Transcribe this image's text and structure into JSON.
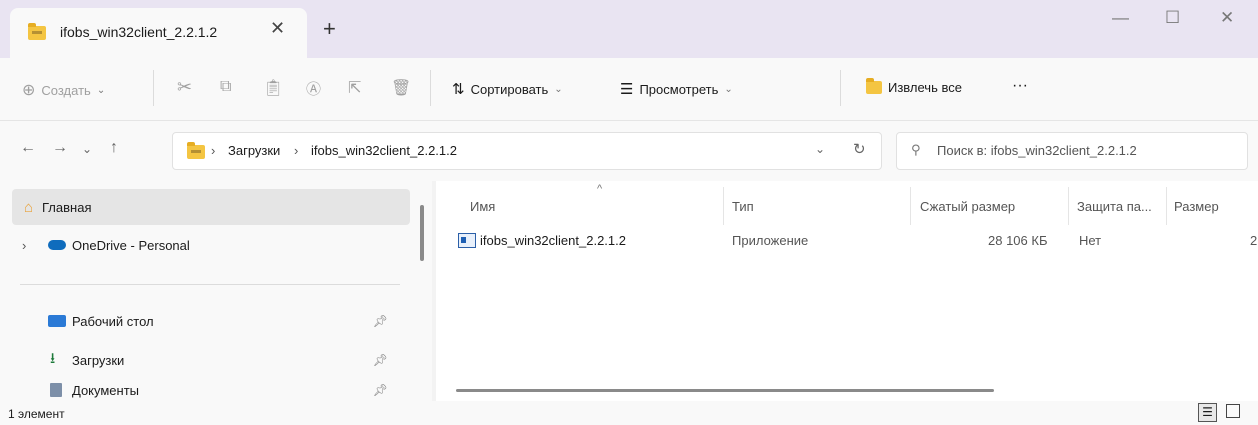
{
  "window": {
    "tab_title": "ifobs_win32client_2.2.1.2",
    "close_tab": "✕",
    "new_tab": "+",
    "minimize": "—",
    "maximize": "☐",
    "close": "✕"
  },
  "toolbar": {
    "create": "Создать",
    "sort": "Сортировать",
    "view": "Просмотреть",
    "extract_all": "Извлечь все",
    "more": "···"
  },
  "address": {
    "path": [
      "Загрузки",
      "ifobs_win32client_2.2.1.2"
    ],
    "search_placeholder": "Поиск в: ifobs_win32client_2.2.1.2"
  },
  "sidebar": {
    "items": [
      {
        "label": "Главная",
        "icon": "home-icon"
      },
      {
        "label": "OneDrive - Personal",
        "icon": "cloud-icon"
      },
      {
        "label": "Рабочий стол",
        "icon": "desktop-icon"
      },
      {
        "label": "Загрузки",
        "icon": "download-icon"
      },
      {
        "label": "Документы",
        "icon": "document-icon"
      }
    ]
  },
  "columns": [
    "Имя",
    "Тип",
    "Сжатый размер",
    "Защита па...",
    "Размер"
  ],
  "files": [
    {
      "name": "ifobs_win32client_2.2.1.2",
      "type": "Приложение",
      "compressed": "28 106 КБ",
      "protected": "Нет",
      "size": "2"
    }
  ],
  "status": {
    "count": "1 элемент"
  },
  "colors": {
    "titlebar": "#e9e4f2",
    "folder": "#f4c542",
    "onedrive": "#0f6cbd",
    "selection": "#e5e5e5"
  }
}
